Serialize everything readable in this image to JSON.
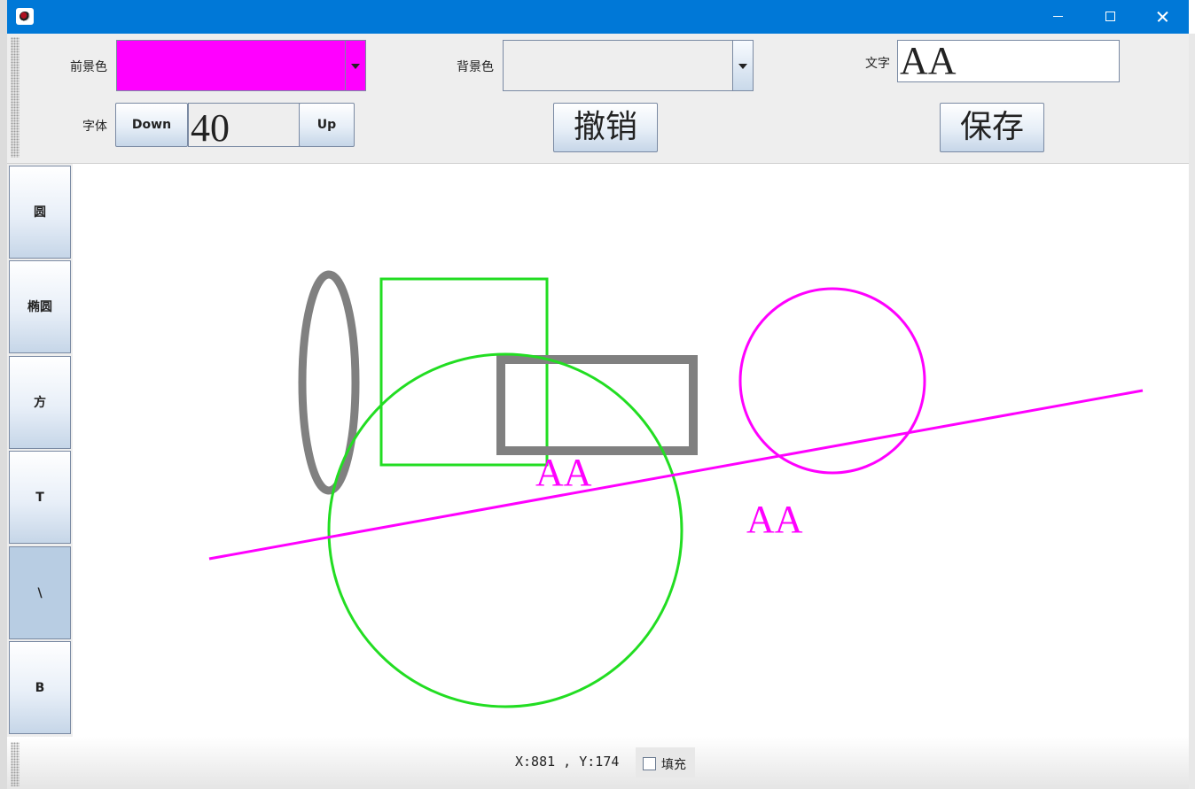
{
  "window": {
    "title": ""
  },
  "toolbar": {
    "fg_label": "前景色",
    "fg_color": "#ff00ff",
    "bg_label": "背景色",
    "text_label": "文字",
    "text_value": "AA",
    "font_label": "字体",
    "down_label": "Down",
    "font_size": "40",
    "up_label": "Up",
    "undo_label": "撤销",
    "save_label": "保存"
  },
  "sidebar": {
    "items": [
      {
        "label": "圆"
      },
      {
        "label": "椭圆"
      },
      {
        "label": "方"
      },
      {
        "label": "T"
      },
      {
        "label": "\\"
      },
      {
        "label": "B"
      }
    ],
    "selected": "\\"
  },
  "canvas": {
    "text_items": [
      "AA",
      "AA"
    ],
    "colors": {
      "magenta": "#ff00ff",
      "green": "#22dd22",
      "gray": "#808080"
    }
  },
  "status": {
    "coords": "X:881 , Y:174",
    "fill_label": "填充",
    "fill_checked": false
  }
}
